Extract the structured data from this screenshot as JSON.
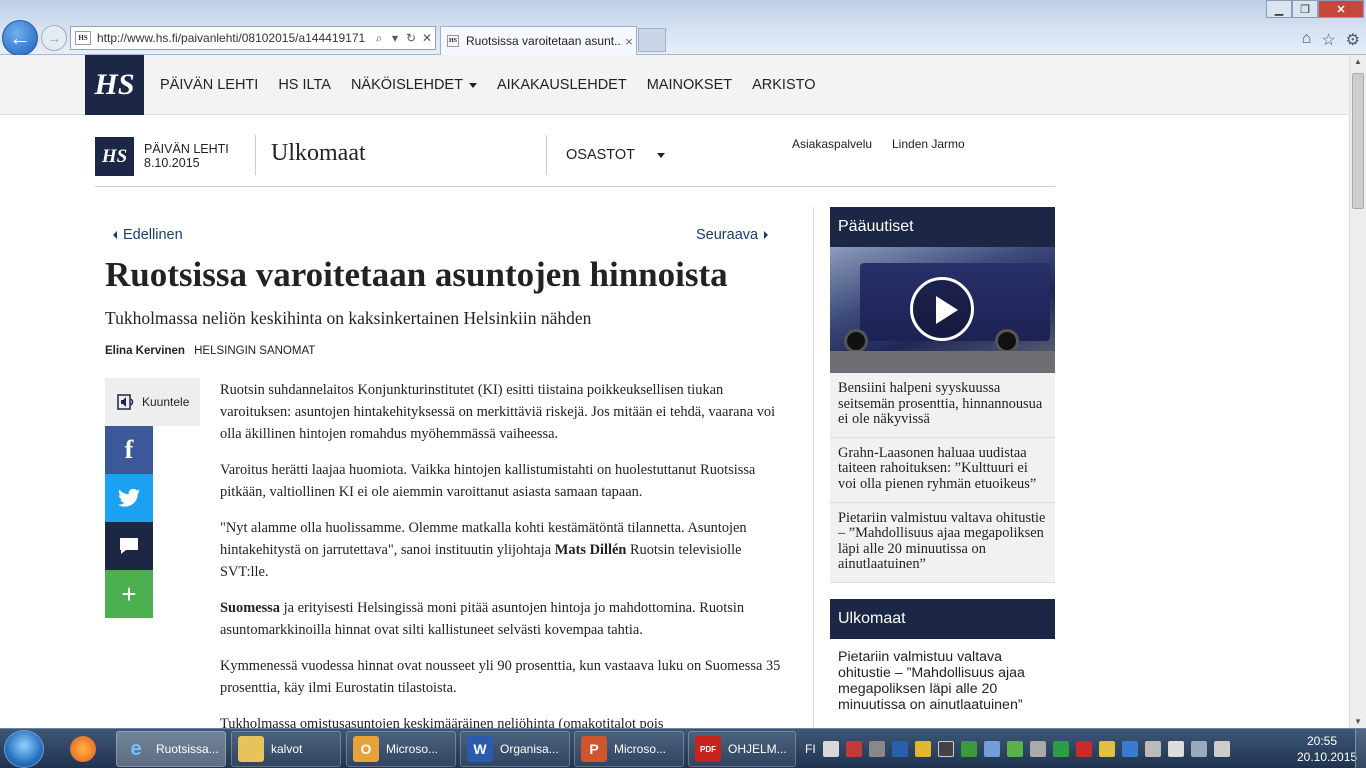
{
  "browser": {
    "url": "http://www.hs.fi/paivanlehti/08102015/a144419171",
    "tab_title": "Ruotsissa varoitetaan asunt...",
    "favicon_text": "HS",
    "tab_close": "×"
  },
  "nav": {
    "logo": "HS",
    "items": [
      "PÄIVÄN LEHTI",
      "HS ILTA",
      "NÄKÖISLEHDET",
      "AIKAKAUSLEHDET",
      "MAINOKSET",
      "ARKISTO"
    ]
  },
  "section_header": {
    "logo": "HS",
    "edition_label": "PÄIVÄN LEHTI",
    "date": "8.10.2015",
    "section": "Ulkomaat",
    "departments": "OSASTOT",
    "customer_service": "Asiakaspalvelu",
    "user": "Linden Jarmo"
  },
  "article": {
    "prev": "Edellinen",
    "next": "Seuraava",
    "headline": "Ruotsissa varoitetaan asuntojen hinnoista",
    "subheadline": "Tukholmassa neliön keskihinta on kaksinkertainen Helsinkiin nähden",
    "author": "Elina Kervinen",
    "publisher": "HELSINGIN SANOMAT",
    "listen": "Kuuntele",
    "paragraphs": [
      "Ruotsin suhdannelaitos Konjunkturinstitutet (KI) esitti tiistaina poikkeuksellisen tiukan varoituksen: asuntojen hintakehityksessä on merkittäviä riskejä. Jos mitään ei tehdä, vaarana voi olla äkillinen hintojen romahdus myöhemmässä vaiheessa.",
      "Varoitus herätti laajaa huomiota. Vaikka hintojen kallistumistahti on huolestuttanut Ruotsissa pitkään, valtiollinen KI ei ole aiemmin varoittanut asiasta samaan tapaan."
    ],
    "p3_start": "\"Nyt alamme olla huolissamme. Olemme matkalla kohti kestämätöntä tilannetta. Asuntojen hintakehitystä on jarrutettava\", sanoi instituutin ylijohtaja ",
    "p3_name": "Mats Dillén",
    "p3_end": " Ruotsin televisiolle SVT:lle.",
    "p4_lead": "Suomessa",
    "p4_rest": " ja erityisesti Helsingissä moni pitää asuntojen hintoja jo mahdottomina. Ruotsin asuntomarkkinoilla hinnat ovat silti kallistuneet selvästi kovempaa tahtia.",
    "p5": "Kymmenessä vuodessa hinnat ovat nousseet yli 90 prosenttia, kun vastaava luku on Suomessa 35 prosenttia, käy ilmi Eurostatin tilastoista.",
    "p6": "Tukholmassa omistusasuntojen keskimääräinen neliöhinta (omakotitalot pois"
  },
  "sidebar": {
    "top_title": "Pääuutiset",
    "top_items": [
      "Bensiini halpeni syyskuussa seitsemän prosenttia, hinnannousua ei ole näkyvissä",
      "Grahn-Laasonen haluaa uudistaa taiteen rahoituksen: ”Kulttuuri ei voi olla pienen ryhmän etuoikeus”",
      "Pietariin valmistuu valtava ohitustie – ”Mahdollisuus ajaa megapoliksen läpi alle 20 minuutissa on ainutlaatuinen”"
    ],
    "section_title": "Ulkomaat",
    "section_items": [
      "Pietariin valmistuu valtava ohitustie – ”Mahdollisuus ajaa megapoliksen läpi alle 20 minuutissa on ainutlaatuinen”"
    ]
  },
  "taskbar": {
    "items": [
      "Ruotsissa...",
      "kalvot",
      "Microso...",
      "Organisa...",
      "Microso...",
      "OHJELM..."
    ],
    "language": "FI",
    "time": "20:55",
    "date": "20.10.2015"
  },
  "colors": {
    "brand_navy": "#1b2745",
    "facebook": "#3b5998",
    "twitter": "#1da1f2",
    "more": "#4caf50"
  }
}
